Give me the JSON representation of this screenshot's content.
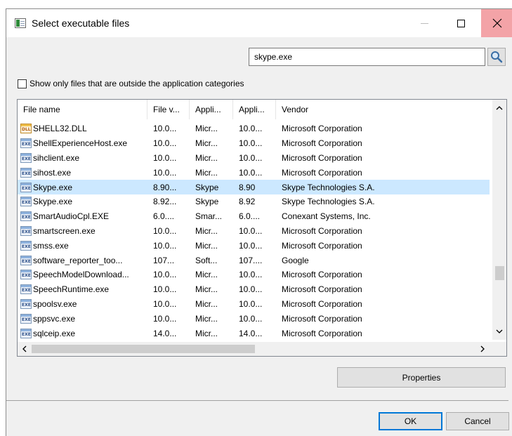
{
  "window": {
    "title": "Select executable files"
  },
  "titlebar": {
    "minimize_label": "—",
    "maximize_label": "☐",
    "close_label": "✕"
  },
  "search": {
    "value": "skype.exe",
    "placeholder": ""
  },
  "filter": {
    "checkbox_label": "Show only files that are outside the application categories",
    "checked": false
  },
  "table": {
    "columns": [
      "File name",
      "File v...",
      "Appli...",
      "Appli...",
      "Vendor"
    ],
    "rows": [
      {
        "icon": "dll-icon",
        "name": "SHELL32.DLL",
        "file_version": "10.0...",
        "app_name": "Micr...",
        "app_version": "10.0...",
        "vendor": "Microsoft Corporation"
      },
      {
        "icon": "exe-icon",
        "name": "ShellExperienceHost.exe",
        "file_version": "10.0...",
        "app_name": "Micr...",
        "app_version": "10.0...",
        "vendor": "Microsoft Corporation"
      },
      {
        "icon": "exe-icon",
        "name": "sihclient.exe",
        "file_version": "10.0...",
        "app_name": "Micr...",
        "app_version": "10.0...",
        "vendor": "Microsoft Corporation"
      },
      {
        "icon": "exe-icon",
        "name": "sihost.exe",
        "file_version": "10.0...",
        "app_name": "Micr...",
        "app_version": "10.0...",
        "vendor": "Microsoft Corporation"
      },
      {
        "icon": "exe-icon",
        "name": "Skype.exe",
        "file_version": "8.90...",
        "app_name": "Skype",
        "app_version": "8.90",
        "vendor": "Skype Technologies S.A.",
        "selected": true
      },
      {
        "icon": "exe-icon",
        "name": "Skype.exe",
        "file_version": "8.92...",
        "app_name": "Skype",
        "app_version": "8.92",
        "vendor": "Skype Technologies S.A."
      },
      {
        "icon": "exe-icon",
        "name": "SmartAudioCpl.EXE",
        "file_version": "6.0....",
        "app_name": "Smar...",
        "app_version": "6.0....",
        "vendor": "Conexant Systems, Inc."
      },
      {
        "icon": "exe-icon",
        "name": "smartscreen.exe",
        "file_version": "10.0...",
        "app_name": "Micr...",
        "app_version": "10.0...",
        "vendor": "Microsoft Corporation"
      },
      {
        "icon": "exe-icon",
        "name": "smss.exe",
        "file_version": "10.0...",
        "app_name": "Micr...",
        "app_version": "10.0...",
        "vendor": "Microsoft Corporation"
      },
      {
        "icon": "exe-icon",
        "name": "software_reporter_too...",
        "file_version": "107...",
        "app_name": "Soft...",
        "app_version": "107....",
        "vendor": "Google"
      },
      {
        "icon": "exe-icon",
        "name": "SpeechModelDownload...",
        "file_version": "10.0...",
        "app_name": "Micr...",
        "app_version": "10.0...",
        "vendor": "Microsoft Corporation"
      },
      {
        "icon": "exe-icon",
        "name": "SpeechRuntime.exe",
        "file_version": "10.0...",
        "app_name": "Micr...",
        "app_version": "10.0...",
        "vendor": "Microsoft Corporation"
      },
      {
        "icon": "exe-icon",
        "name": "spoolsv.exe",
        "file_version": "10.0...",
        "app_name": "Micr...",
        "app_version": "10.0...",
        "vendor": "Microsoft Corporation"
      },
      {
        "icon": "exe-icon",
        "name": "sppsvc.exe",
        "file_version": "10.0...",
        "app_name": "Micr...",
        "app_version": "10.0...",
        "vendor": "Microsoft Corporation"
      },
      {
        "icon": "exe-icon",
        "name": "sqlceip.exe",
        "file_version": "14.0...",
        "app_name": "Micr...",
        "app_version": "14.0...",
        "vendor": "Microsoft Corporation"
      }
    ]
  },
  "icon_labels": {
    "dll": "DLL",
    "exe": "EXE"
  },
  "buttons": {
    "properties": "Properties",
    "ok": "OK",
    "cancel": "Cancel"
  },
  "colors": {
    "selection": "#cce8ff",
    "close_hover": "#f3a3a7",
    "default_button_border": "#0078d7"
  }
}
